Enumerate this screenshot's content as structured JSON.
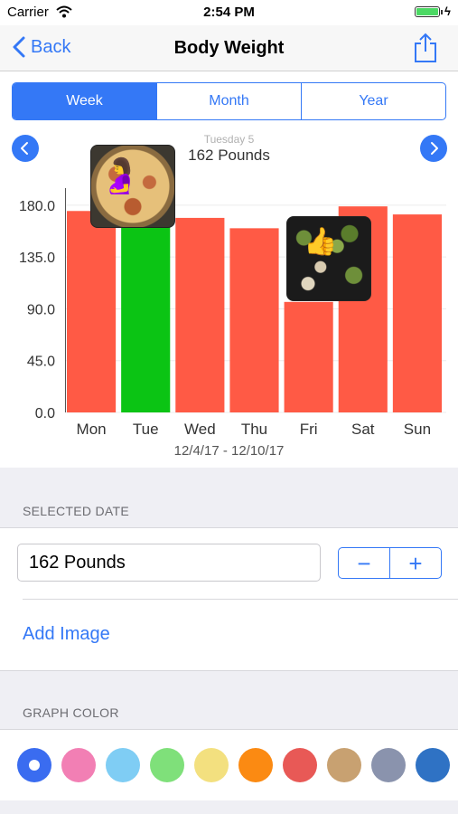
{
  "status_bar": {
    "carrier": "Carrier",
    "time": "2:54 PM",
    "charging_glyph": "ϟ"
  },
  "nav": {
    "back_label": "Back",
    "title": "Body Weight",
    "share_icon": "share-icon",
    "back_icon": "chevron-left-icon"
  },
  "segments": [
    {
      "label": "Week",
      "selected": true
    },
    {
      "label": "Month",
      "selected": false
    },
    {
      "label": "Year",
      "selected": false
    }
  ],
  "chart_header": {
    "date": "Tuesday 5",
    "value": "162 Pounds"
  },
  "chart_data": {
    "type": "bar",
    "categories": [
      "Mon",
      "Tue",
      "Wed",
      "Thu",
      "Fri",
      "Sat",
      "Sun"
    ],
    "values": [
      175,
      162,
      169,
      160,
      96,
      179,
      172
    ],
    "ylim": [
      0,
      198
    ],
    "yticks": [
      0,
      45,
      90,
      135,
      180
    ],
    "ytick_labels": [
      "0.0",
      "45.0",
      "90.0",
      "135.0",
      "180.0"
    ],
    "selected_index": 1,
    "bar_color": "#ff5a45",
    "selected_bar_color": "#0bc414",
    "xlabel": "12/4/17 - 12/10/17",
    "grid": true
  },
  "selected_date": {
    "header": "SELECTED DATE",
    "value": "162 Pounds",
    "minus": "−",
    "plus": "+",
    "add_image": "Add Image"
  },
  "graph_color": {
    "header": "GRAPH COLOR",
    "colors": [
      "#3a6cf0",
      "#f27fb4",
      "#7fcdf4",
      "#7fe07a",
      "#f3e07f",
      "#fb8a12",
      "#e85956",
      "#c8a171",
      "#8a93ad",
      "#2f72c4"
    ],
    "selected_index": 0
  },
  "accent_color": "#3478f6"
}
